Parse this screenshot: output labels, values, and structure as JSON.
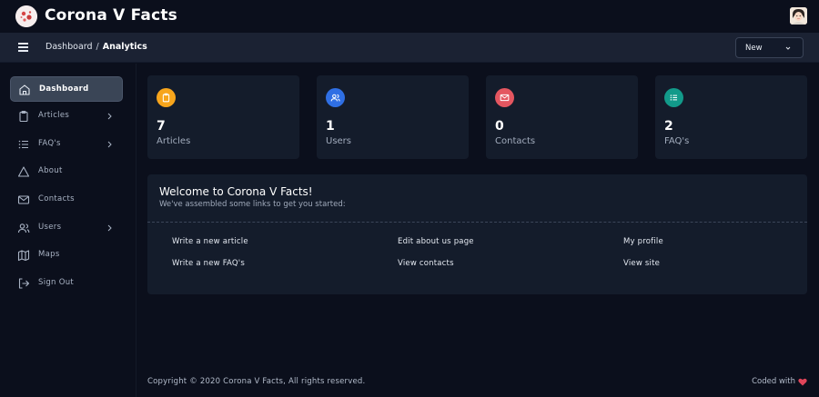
{
  "header": {
    "title": "Corona V Facts",
    "logo_icon": "virus-logo-icon",
    "avatar_icon": "user-avatar"
  },
  "subbar": {
    "breadcrumb": {
      "parent": "Dashboard",
      "separator": "/",
      "current": "Analytics"
    },
    "new_select": {
      "value": "New"
    }
  },
  "sidebar": {
    "items": [
      {
        "label": "Dashboard",
        "icon": "home-icon",
        "active": true,
        "has_arrow": false
      },
      {
        "label": "Articles",
        "icon": "clipboard-icon",
        "active": false,
        "has_arrow": true
      },
      {
        "label": "FAQ's",
        "icon": "list-icon",
        "active": false,
        "has_arrow": true
      },
      {
        "label": "About",
        "icon": "triangle-icon",
        "active": false,
        "has_arrow": false
      },
      {
        "label": "Contacts",
        "icon": "mail-icon",
        "active": false,
        "has_arrow": false
      },
      {
        "label": "Users",
        "icon": "users-icon",
        "active": false,
        "has_arrow": true
      },
      {
        "label": "Maps",
        "icon": "map-icon",
        "active": false,
        "has_arrow": false
      },
      {
        "label": "Sign Out",
        "icon": "sign-out-icon",
        "active": false,
        "has_arrow": false
      }
    ]
  },
  "stats": [
    {
      "count": "7",
      "label": "Articles",
      "icon": "clipboard-icon",
      "color": "#f7a51c"
    },
    {
      "count": "1",
      "label": "Users",
      "icon": "users-icon",
      "color": "#2f6fe4"
    },
    {
      "count": "0",
      "label": "Contacts",
      "icon": "mail-icon",
      "color": "#e45660"
    },
    {
      "count": "2",
      "label": "FAQ's",
      "icon": "list-icon",
      "color": "#129a8a"
    }
  ],
  "welcome": {
    "title": "Welcome to Corona V Facts!",
    "subtitle": "We've assembled some links to get you started:",
    "links": [
      [
        "Write a new article",
        "Edit about us page",
        "My profile"
      ],
      [
        "Write a new FAQ's",
        "View contacts",
        "View site"
      ]
    ]
  },
  "footer": {
    "copyright": "Copyright © 2020 Corona V Facts, All rights reserved.",
    "coded_with": "Coded with",
    "heart_color": "#e0455a"
  }
}
